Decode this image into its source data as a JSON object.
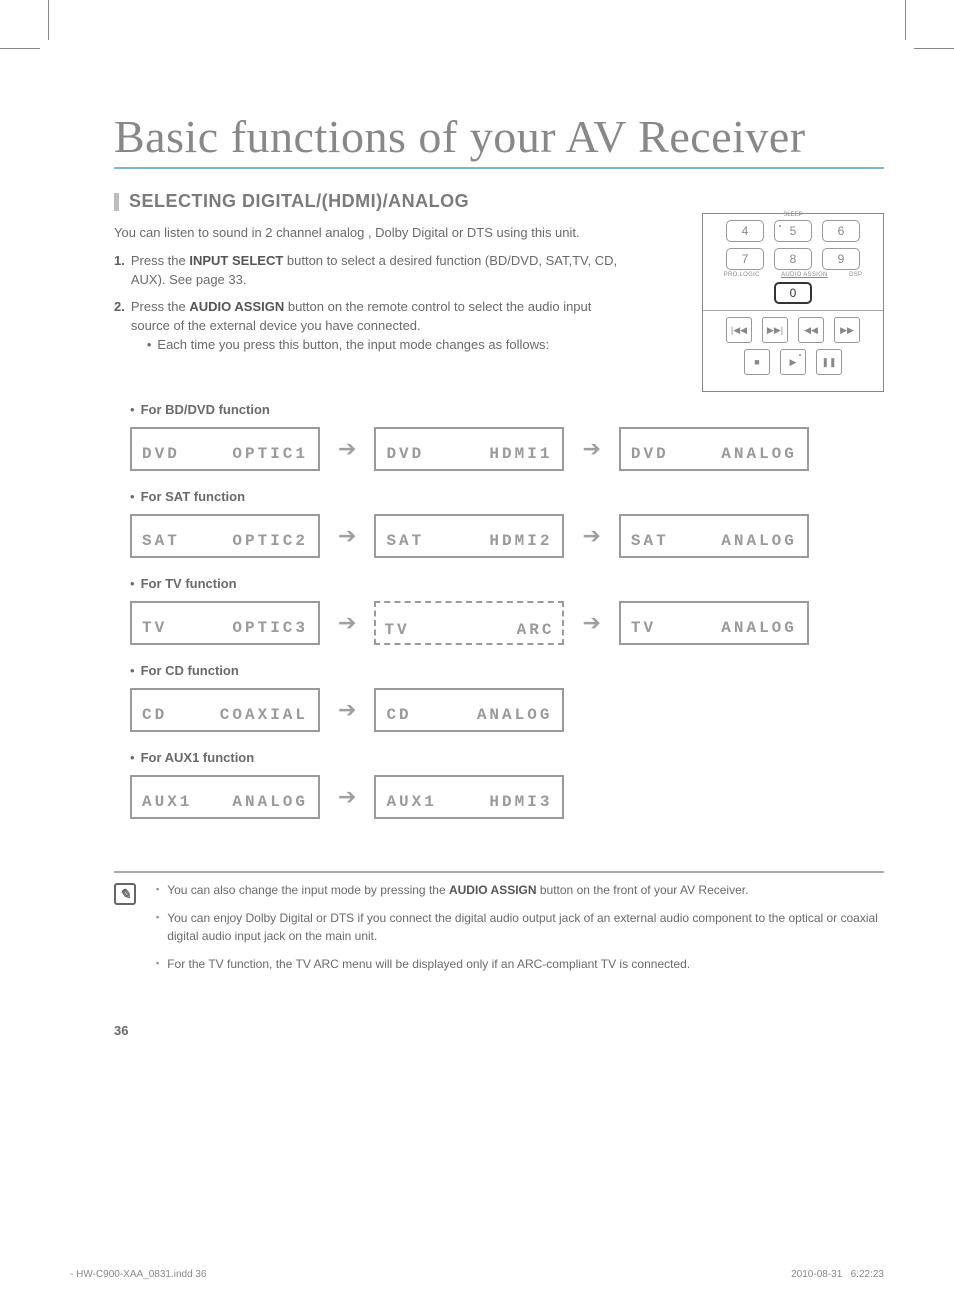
{
  "title": "Basic functions of your AV Receiver",
  "section": {
    "title": "SELECTING DIGITAL/(HDMI)/ANALOG"
  },
  "intro": "You can listen to sound in 2 channel analog , Dolby Digital or DTS using this unit.",
  "steps": {
    "s1_num": "1.",
    "s1_pre": "Press the ",
    "s1_bold": "INPUT SELECT",
    "s1_post": " button to select a desired function (BD/DVD, SAT,TV, CD, AUX). See page 33.",
    "s2_num": "2.",
    "s2_pre": "Press the ",
    "s2_bold": "AUDIO ASSIGN",
    "s2_post": " button on the remote control to select the audio input source of the  external device you have connected.",
    "s2_bullet": "Each time you press this button, the input mode changes as follows:"
  },
  "remote": {
    "k4": "4",
    "k5": "5",
    "k6": "6",
    "k7": "7",
    "k8": "8",
    "k9": "9",
    "k0": "0",
    "lab_sleep": "SLEEP",
    "lab_prologic": "PRO.LOGIC",
    "lab_audioassign": "AUDIO ASSIGN",
    "lab_dsp": "DSP",
    "t1": "|◀◀",
    "t2": "▶▶|",
    "t3": "◀◀",
    "t4": "▶▶",
    "p1": "■",
    "p2": "▶",
    "p3": "❚❚"
  },
  "funcs": {
    "bd_label": "For BD/DVD function",
    "bd": [
      {
        "l": "DVD",
        "r": "OPTIC1"
      },
      {
        "l": "DVD",
        "r": "HDMI1"
      },
      {
        "l": "DVD",
        "r": "ANALOG"
      }
    ],
    "sat_label": "For SAT function",
    "sat": [
      {
        "l": "SAT",
        "r": "OPTIC2"
      },
      {
        "l": "SAT",
        "r": "HDMI2"
      },
      {
        "l": "SAT",
        "r": "ANALOG"
      }
    ],
    "tv_label": "For TV function",
    "tv": [
      {
        "l": "TV",
        "r": "OPTIC3"
      },
      {
        "l": "TV",
        "r": "ARC"
      },
      {
        "l": "TV",
        "r": "ANALOG"
      }
    ],
    "cd_label": "For CD function",
    "cd": [
      {
        "l": "CD",
        "r": "COAXIAL"
      },
      {
        "l": "CD",
        "r": "ANALOG"
      }
    ],
    "aux_label": "For AUX1 function",
    "aux": [
      {
        "l": "AUX1",
        "r": "ANALOG"
      },
      {
        "l": "AUX1",
        "r": "HDMI3"
      }
    ]
  },
  "notes": {
    "n1_pre": "You can also change the input mode by pressing the ",
    "n1_bold": "AUDIO ASSIGN",
    "n1_post": " button on the front of your AV Receiver.",
    "n2": "You can enjoy Dolby Digital or DTS if you connect the digital audio output jack of an external audio component to the optical or coaxial digital audio input jack on the main unit.",
    "n3": "For the TV function, the TV ARC menu will be displayed only if an ARC-compliant TV is connected."
  },
  "page_num": "36",
  "footer": {
    "left": "- HW-C900-XAA_0831.indd   36",
    "date": "2010-08-31",
    "time": "6:22:23"
  }
}
